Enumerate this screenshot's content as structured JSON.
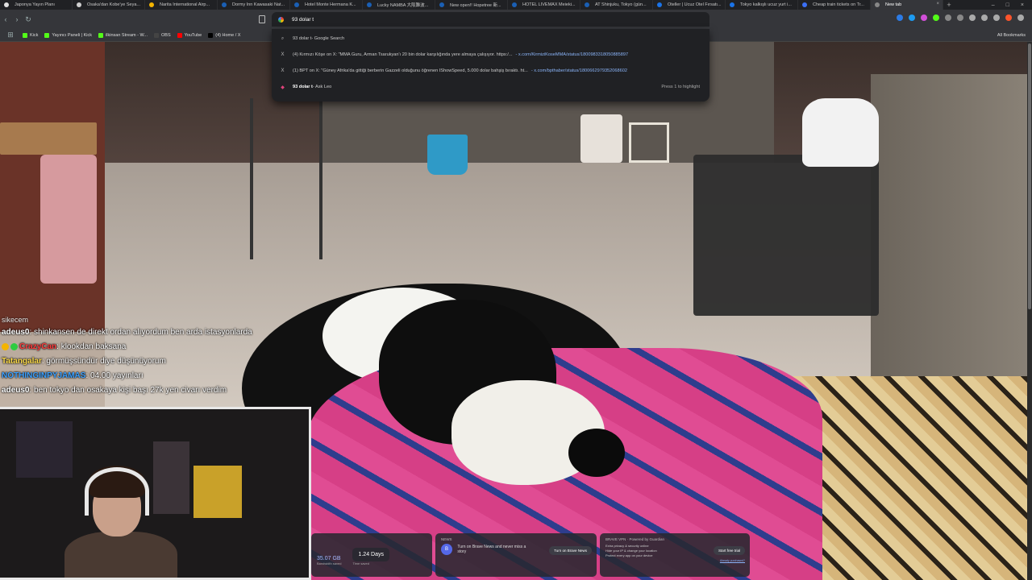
{
  "tabs": [
    {
      "label": "Japonya Yayın Planı",
      "color": "#e0e0e0"
    },
    {
      "label": "Osaka'dan Kobe'ye Seya...",
      "color": "#cfcfcf"
    },
    {
      "label": "Narita International Airp...",
      "color": "#f4b400"
    },
    {
      "label": "Dormy Inn Kawasaki Nat...",
      "color": "#1a5fb4"
    },
    {
      "label": "Hotel Monte Hermana K...",
      "color": "#1a5fb4"
    },
    {
      "label": "Lucky NAMBA 大阪難波...",
      "color": "#1a5fb4"
    },
    {
      "label": "New open!! Hopetree 新...",
      "color": "#1a5fb4"
    },
    {
      "label": "HOTEL LIVEMAX Meieki...",
      "color": "#1a5fb4"
    },
    {
      "label": "AT Shinjuku, Tokyo (gün...",
      "color": "#1a5fb4"
    },
    {
      "label": "Oteller | Ucuz Otel Fırsatı...",
      "color": "#1a73e8"
    },
    {
      "label": "Tokyo kalkışlı ucuz yurt i...",
      "color": "#1a73e8"
    },
    {
      "label": "Cheap train tickets on Tr...",
      "color": "#3b6ff5"
    },
    {
      "label": "New tab",
      "color": "#888888",
      "active": true
    }
  ],
  "omnibox": {
    "value": "93 dolar t"
  },
  "bookmarks": [
    {
      "label": "Kick",
      "color": "#53fc18"
    },
    {
      "label": "Yayıncı Paneli | Kick",
      "color": "#53fc18"
    },
    {
      "label": "ilkinsan Stream - W...",
      "color": "#53fc18"
    },
    {
      "label": "OBS",
      "color": "#444444"
    },
    {
      "label": "YouTube",
      "color": "#ff0000"
    },
    {
      "label": "(4) Home / X",
      "color": "#000000"
    }
  ],
  "all_bookmarks": "All Bookmarks",
  "suggestions": [
    {
      "icon": "search",
      "text": "93 dolar t",
      "suffix": " - Google Search",
      "url": ""
    },
    {
      "icon": "x",
      "text": "(4) Kırmızı Köşe on X: \"MMA Guru, Arman Tsarukyan'ı 20 bin dolar karşılığında yere almaya çalışıyor. https:/...",
      "suffix": "",
      "url": "- x.com/KirmiziKoseMMA/status/1800983318050885897"
    },
    {
      "icon": "x",
      "text": "(1) BPT on X: \"Güney Afrika'da gittiği berberin Gazzeli olduğunu öğrenen IShowSpeed, 5.000 dolar bahşiş bıraktı. ht...",
      "suffix": "",
      "url": "- x.com/bpthaber/status/1800662979352068602"
    },
    {
      "icon": "leo",
      "text": "93 dolar t",
      "suffix": " - Ask Leo",
      "url": "",
      "hint": "Press 1 to highlight"
    }
  ],
  "chat": {
    "title": "sikecem",
    "messages": [
      {
        "user": "adeus0",
        "color": "#ffffff",
        "text": ": shinkansen de direkt ordan alıyordum ben arda istasyonlarda"
      },
      {
        "user": "CrazyCan",
        "color": "#ff3b3b",
        "badges": [
          "#f4b400",
          "#2ecc40"
        ],
        "text": ": klookdan baksana"
      },
      {
        "user": "Tatangalar",
        "color": "#f9d84a",
        "text": ": görmüşsündür diye düşünüyorum"
      },
      {
        "user": "NOTHINGINPYJAMAS",
        "color": "#3aa0ff",
        "text": ": 04.00 yayınları"
      },
      {
        "user": "adeus0",
        "color": "#ffffff",
        "text": ": ben tokyo dan osakaya kişi başı 27k yen civarı verdim"
      }
    ]
  },
  "widgets": {
    "stats": [
      {
        "value": "35.07",
        "unit": "GB",
        "label": "Bandwidth saved"
      },
      {
        "value": "1.24",
        "unit": "Days",
        "label": "Time saved"
      }
    ],
    "news": {
      "head": "NEWS",
      "text": "Turn on Brave News and never miss a story",
      "button": "Turn on Brave News"
    },
    "vpn": {
      "head": "BRAVE VPN",
      "powered": "Powered by Guardian",
      "items": [
        "Extra privacy & security online",
        "Hide your IP & change your location",
        "Protect every app on your device"
      ],
      "button": "Start free trial",
      "link": "Already purchased?"
    }
  }
}
